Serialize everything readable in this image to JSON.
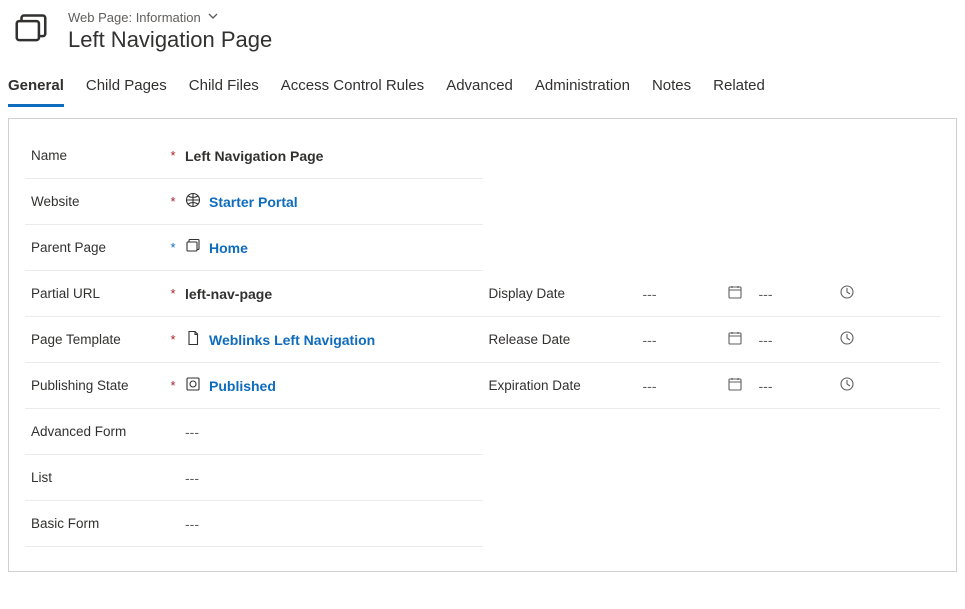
{
  "header": {
    "breadcrumb": "Web Page: Information",
    "title": "Left Navigation Page"
  },
  "tabs": [
    {
      "id": "general",
      "label": "General",
      "active": true
    },
    {
      "id": "child-pages",
      "label": "Child Pages",
      "active": false
    },
    {
      "id": "child-files",
      "label": "Child Files",
      "active": false
    },
    {
      "id": "access-control-rules",
      "label": "Access Control Rules",
      "active": false
    },
    {
      "id": "advanced",
      "label": "Advanced",
      "active": false
    },
    {
      "id": "administration",
      "label": "Administration",
      "active": false
    },
    {
      "id": "notes",
      "label": "Notes",
      "active": false
    },
    {
      "id": "related",
      "label": "Related",
      "active": false
    }
  ],
  "fields": {
    "name": {
      "label": "Name",
      "value": "Left Navigation Page",
      "required": "red"
    },
    "website": {
      "label": "Website",
      "value": "Starter Portal",
      "required": "red"
    },
    "parent_page": {
      "label": "Parent Page",
      "value": "Home",
      "required": "blue"
    },
    "partial_url": {
      "label": "Partial URL",
      "value": "left-nav-page",
      "required": "red"
    },
    "page_template": {
      "label": "Page Template",
      "value": "Weblinks Left Navigation",
      "required": "red"
    },
    "publishing_state": {
      "label": "Publishing State",
      "value": "Published",
      "required": "red"
    },
    "advanced_form": {
      "label": "Advanced Form",
      "value": "---"
    },
    "list": {
      "label": "List",
      "value": "---"
    },
    "basic_form": {
      "label": "Basic Form",
      "value": "---"
    },
    "display_date": {
      "label": "Display Date",
      "date": "---",
      "time": "---"
    },
    "release_date": {
      "label": "Release Date",
      "date": "---",
      "time": "---"
    },
    "expiration_date": {
      "label": "Expiration Date",
      "date": "---",
      "time": "---"
    }
  },
  "req_marker": "*"
}
